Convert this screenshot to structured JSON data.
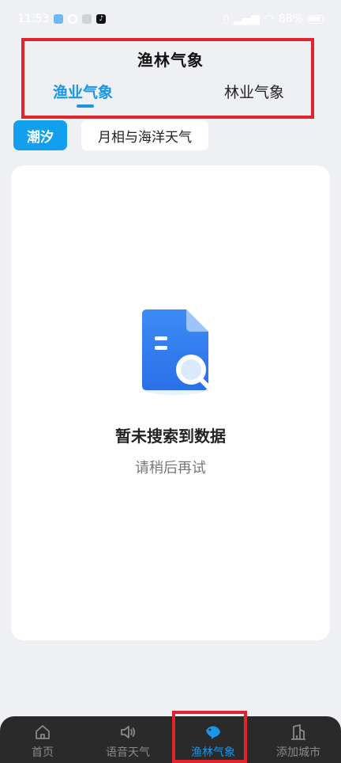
{
  "status_bar": {
    "time": "11:53",
    "battery": "88%",
    "icons": [
      "weather-app-icon",
      "sync-icon",
      "gallery-icon",
      "tiktok-icon",
      "vibrate-icon",
      "signal-icon",
      "wifi-icon",
      "battery-icon"
    ]
  },
  "header": {
    "title": "渔林气象",
    "tabs": [
      {
        "label": "渔业气象",
        "active": true
      },
      {
        "label": "林业气象",
        "active": false
      }
    ]
  },
  "chips": [
    {
      "label": "潮汐",
      "active": true
    },
    {
      "label": "月相与海洋天气",
      "active": false
    }
  ],
  "empty_state": {
    "icon": "document-search-icon",
    "title": "暂未搜索到数据",
    "subtitle": "请稍后再试"
  },
  "bottom_nav": [
    {
      "label": "首页",
      "icon": "home-icon",
      "active": false
    },
    {
      "label": "语音天气",
      "icon": "speaker-icon",
      "active": false
    },
    {
      "label": "渔林气象",
      "icon": "fish-icon",
      "active": true
    },
    {
      "label": "添加城市",
      "icon": "building-icon",
      "active": false
    }
  ],
  "colors": {
    "accent": "#1a96e8",
    "chip_active": "#12a0ee",
    "highlight": "#e0242e",
    "nav_bg": "#2a2a2a",
    "page_bg": "#eef0f3"
  }
}
